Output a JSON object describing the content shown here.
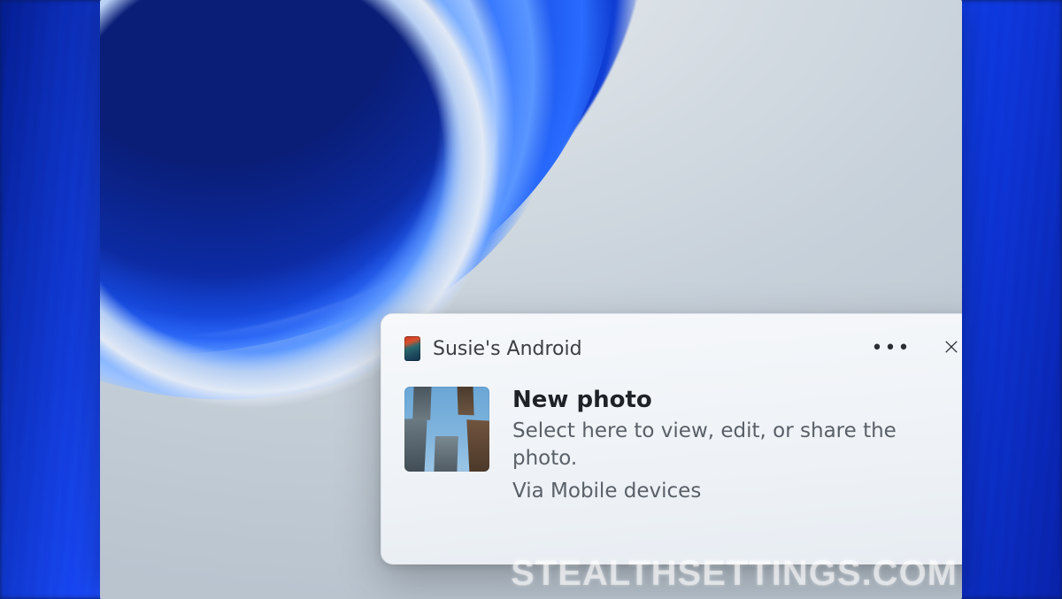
{
  "notification": {
    "device_name": "Susie's Android",
    "title": "New photo",
    "description": "Select here to view, edit, or share the photo.",
    "source": "Via Mobile devices"
  },
  "icons": {
    "more": "more-options-icon",
    "close": "close-icon",
    "device": "phone-icon",
    "thumbnail": "photo-thumbnail"
  },
  "watermark": "STEALTHSETTINGS.COM"
}
